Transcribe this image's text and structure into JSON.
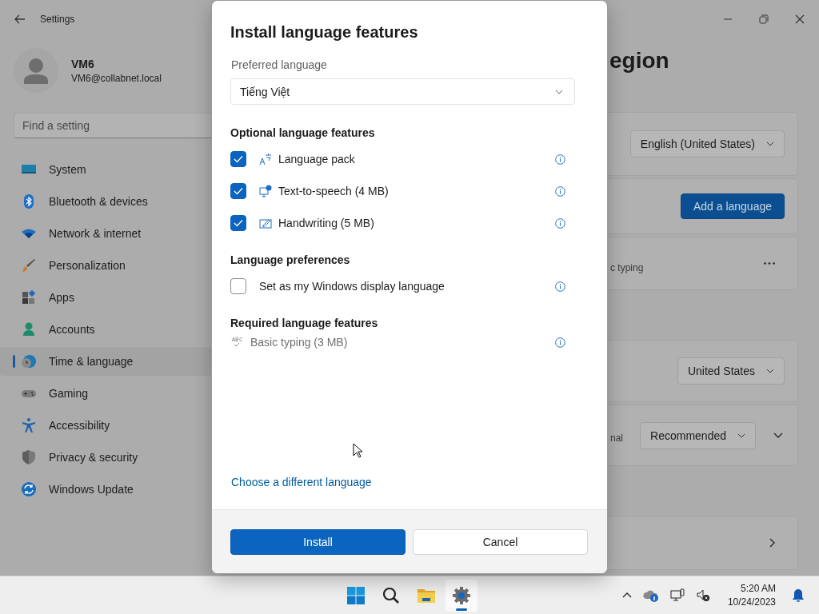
{
  "window": {
    "title": "Settings"
  },
  "user": {
    "name": "VM6",
    "email": "VM6@collabnet.local"
  },
  "search": {
    "placeholder": "Find a setting"
  },
  "nav": [
    {
      "label": "System",
      "selected": false
    },
    {
      "label": "Bluetooth & devices",
      "selected": false
    },
    {
      "label": "Network & internet",
      "selected": false
    },
    {
      "label": "Personalization",
      "selected": false
    },
    {
      "label": "Apps",
      "selected": false
    },
    {
      "label": "Accounts",
      "selected": false
    },
    {
      "label": "Time & language",
      "selected": true
    },
    {
      "label": "Gaming",
      "selected": false
    },
    {
      "label": "Accessibility",
      "selected": false
    },
    {
      "label": "Privacy & security",
      "selected": false
    },
    {
      "label": "Windows Update",
      "selected": false
    }
  ],
  "page_title": "egion",
  "card_groups": [
    {
      "cards": [
        {
          "kind": "dropdown",
          "value": "English (United States)"
        },
        {
          "kind": "button",
          "label": "Add a language"
        },
        {
          "kind": "more",
          "text": "c typing"
        }
      ]
    },
    {
      "cards": [
        {
          "kind": "dropdown",
          "value": "United States"
        },
        {
          "kind": "dropdown_expand",
          "text": "nal",
          "value": "Recommended"
        }
      ]
    },
    {
      "cards": [
        {
          "kind": "chevron"
        }
      ]
    }
  ],
  "dialog": {
    "title": "Install language features",
    "preferred_label": "Preferred language",
    "language": "Tiếng Việt",
    "sections": [
      {
        "heading": "Optional language features",
        "items": [
          {
            "kind": "feature",
            "label": "Language pack",
            "checked": true
          },
          {
            "kind": "feature",
            "label": "Text-to-speech (4 MB)",
            "checked": true
          },
          {
            "kind": "feature",
            "label": "Handwriting (5 MB)",
            "checked": true
          }
        ]
      },
      {
        "heading": "Language preferences",
        "items": [
          {
            "kind": "option",
            "label": "Set as my Windows display language",
            "checked": false
          }
        ]
      },
      {
        "heading": "Required language features",
        "items": [
          {
            "kind": "required",
            "label": "Basic typing (3 MB)"
          }
        ]
      }
    ],
    "link": "Choose a different language",
    "buttons": [
      {
        "kind": "primary",
        "label": "Install"
      },
      {
        "kind": "secondary",
        "label": "Cancel"
      }
    ]
  },
  "taskbar": {
    "apps": [
      {
        "selected": false
      },
      {
        "selected": false
      },
      {
        "selected": false
      },
      {
        "selected": true
      }
    ],
    "time": "5:20 AM",
    "date": "10/24/2023"
  }
}
